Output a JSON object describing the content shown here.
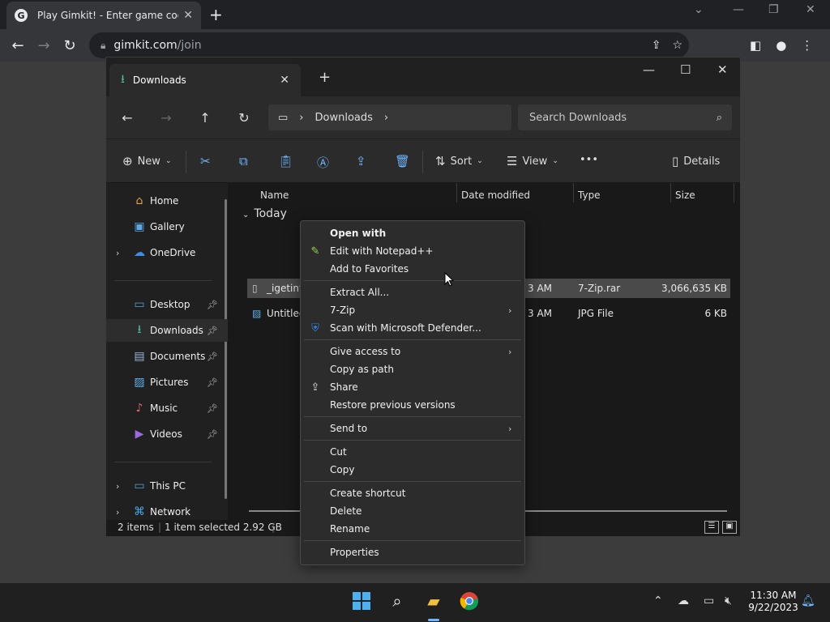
{
  "browser": {
    "tab_title": "Play Gimkit! - Enter game code h",
    "tab_favicon": "G",
    "url_host": "gimkit.com",
    "url_path": "/join"
  },
  "explorer": {
    "tab_title": "Downloads",
    "breadcrumb": "Downloads",
    "search_placeholder": "Search Downloads",
    "toolbar": {
      "new_label": "New",
      "sort_label": "Sort",
      "view_label": "View",
      "more_label": "•••",
      "details_label": "Details"
    },
    "nav": [
      {
        "label": "Home",
        "icon": "home-icon",
        "glyph": "⌂",
        "color": "#e8a34a",
        "chevron": false,
        "pinned": false
      },
      {
        "label": "Gallery",
        "icon": "gallery-icon",
        "glyph": "▣",
        "color": "#5aa9e6",
        "chevron": false,
        "pinned": false
      },
      {
        "label": "OneDrive",
        "icon": "onedrive-icon",
        "glyph": "☁",
        "color": "#3d8ee0",
        "chevron": true,
        "pinned": false
      },
      {
        "label": "Desktop",
        "icon": "desktop-icon",
        "glyph": "▭",
        "color": "#4aa3e0",
        "chevron": false,
        "pinned": true
      },
      {
        "label": "Downloads",
        "icon": "downloads-icon",
        "glyph": "⭳",
        "color": "#4cc2a0",
        "chevron": false,
        "pinned": true,
        "selected": true
      },
      {
        "label": "Documents",
        "icon": "documents-icon",
        "glyph": "▤",
        "color": "#9ab7d8",
        "chevron": false,
        "pinned": true
      },
      {
        "label": "Pictures",
        "icon": "pictures-icon",
        "glyph": "▨",
        "color": "#5fb0e8",
        "chevron": false,
        "pinned": true
      },
      {
        "label": "Music",
        "icon": "music-icon",
        "glyph": "♪",
        "color": "#e06a6a",
        "chevron": false,
        "pinned": true
      },
      {
        "label": "Videos",
        "icon": "videos-icon",
        "glyph": "▶",
        "color": "#9b6ae0",
        "chevron": false,
        "pinned": true
      },
      {
        "label": "This PC",
        "icon": "this-pc-icon",
        "glyph": "▭",
        "color": "#4aa3e0",
        "chevron": true,
        "pinned": false
      },
      {
        "label": "Network",
        "icon": "network-icon",
        "glyph": "⌘",
        "color": "#4aa3e0",
        "chevron": true,
        "pinned": false
      }
    ],
    "columns": [
      "Name",
      "Date modified",
      "Type",
      "Size"
    ],
    "group_label": "Today",
    "files": [
      {
        "name": "_igetintc",
        "date": "3 AM",
        "type": "7-Zip.rar",
        "size": "3,066,635 KB",
        "selected": true
      },
      {
        "name": "Untitled",
        "date": "3 AM",
        "type": "JPG File",
        "size": "6 KB",
        "selected": false
      }
    ],
    "status": {
      "items": "2 items",
      "selected": "1 item selected  2.92 GB"
    }
  },
  "context_menu": {
    "groups": [
      [
        {
          "label": "Open with",
          "bold": true
        },
        {
          "label": "Edit with Notepad++",
          "icon": "notepad-plus-plus-icon",
          "glyph": "✎",
          "color": "#9bd14a"
        },
        {
          "label": "Add to Favorites"
        }
      ],
      [
        {
          "label": "Extract All..."
        },
        {
          "label": "7-Zip",
          "submenu": true
        },
        {
          "label": "Scan with Microsoft Defender...",
          "icon": "defender-shield-icon",
          "glyph": "⛨",
          "color": "#2f86e6"
        }
      ],
      [
        {
          "label": "Give access to",
          "submenu": true
        },
        {
          "label": "Copy as path"
        },
        {
          "label": "Share",
          "icon": "share-icon",
          "glyph": "⇪",
          "color": "#dddddd"
        },
        {
          "label": "Restore previous versions"
        }
      ],
      [
        {
          "label": "Send to",
          "submenu": true
        }
      ],
      [
        {
          "label": "Cut"
        },
        {
          "label": "Copy"
        }
      ],
      [
        {
          "label": "Create shortcut"
        },
        {
          "label": "Delete"
        },
        {
          "label": "Rename"
        }
      ],
      [
        {
          "label": "Properties"
        }
      ]
    ]
  },
  "taskbar": {
    "time": "11:30 AM",
    "date": "9/22/2023"
  }
}
